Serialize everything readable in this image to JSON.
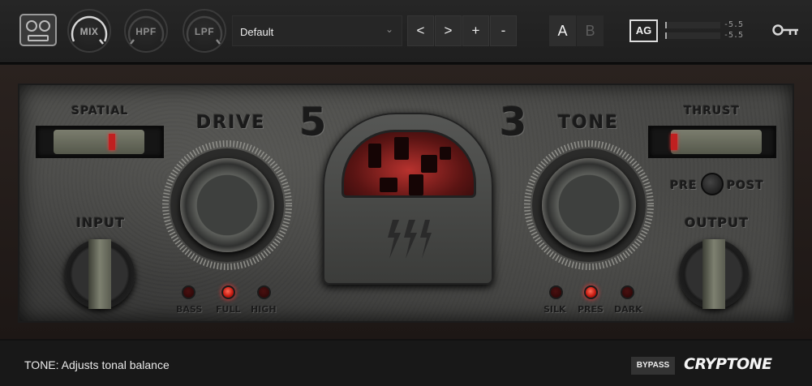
{
  "topbar": {
    "knobs": {
      "mix": "MIX",
      "hpf": "HPF",
      "lpf": "LPF"
    },
    "preset": {
      "name": "Default",
      "chevron": "⌄"
    },
    "nav": {
      "prev": "<",
      "next": ">",
      "add": "+",
      "remove": "-"
    },
    "ab": {
      "a": "A",
      "b": "B",
      "active": "A"
    },
    "ag_label": "AG",
    "meters": {
      "left": "-5.5",
      "right": "-5.5"
    },
    "icons": {
      "tape": "tape-recorder-icon",
      "key": "key-icon"
    }
  },
  "panel": {
    "labels": {
      "spatial": "SPATIAL",
      "drive": "DRIVE",
      "tone": "TONE",
      "thrust": "THRUST",
      "input": "INPUT",
      "output": "OUTPUT",
      "pre": "PRE",
      "post": "POST",
      "model_left": "5",
      "model_right": "3"
    },
    "drive_leds": [
      {
        "label": "BASS",
        "on": false
      },
      {
        "label": "FULL",
        "on": true
      },
      {
        "label": "HIGH",
        "on": false
      }
    ],
    "tone_leds": [
      {
        "label": "SILK",
        "on": false
      },
      {
        "label": "PRES",
        "on": true
      },
      {
        "label": "DARK",
        "on": false
      }
    ],
    "accent_red": "#c81c12"
  },
  "statusbar": {
    "message": "TONE: Adjusts tonal balance",
    "bypass": "BYPASS",
    "brand": "CRYPTONE"
  }
}
